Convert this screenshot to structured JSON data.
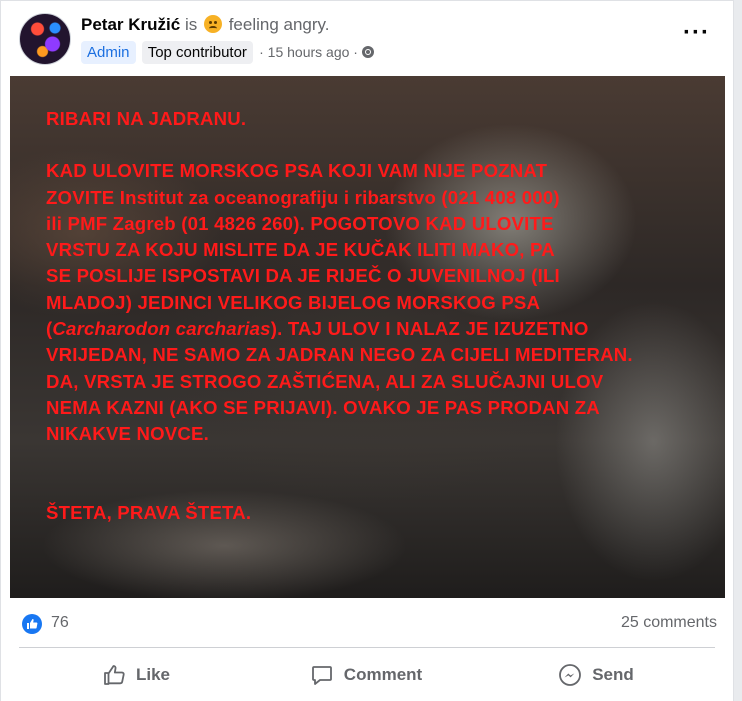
{
  "post": {
    "author": "Petar Kružić",
    "activity_prefix": "is",
    "feeling_icon": "angry-face-icon",
    "feeling": "feeling angry.",
    "badges": {
      "admin": "Admin",
      "top": "Top contributor"
    },
    "time": "· 15 hours ago ·",
    "privacy_icon": "globe-icon",
    "more_label": "···"
  },
  "image_text": {
    "title": "RIBARI NA JADRANU.",
    "lines": [
      "KAD ULOVITE MORSKOG PSA KOJI VAM NIJE POZNAT",
      "ZOVITE Institut za oceanografiju i ribarstvo (021 408 000)",
      "ili PMF Zagreb (01 4826 260). POGOTOVO KAD ULOVITE",
      "VRSTU ZA KOJU MISLITE DA JE KUČAK ILITI MAKO, PA",
      "SE POSLIJE ISPOSTAVI DA JE RIJEČ O JUVENILNOJ (ILI",
      "MLADOJ) JEDINCI VELIKOG BIJELOG MORSKOG PSA"
    ],
    "species_open": "(",
    "species": "Carcharodon carcharias",
    "species_rest": "). TAJ ULOV I NALAZ JE IZUZETNO",
    "lines2": [
      "VRIJEDAN, NE SAMO ZA JADRAN NEGO ZA CIJELI MEDITERAN.",
      "DA, VRSTA JE STROGO ZAŠTIĆENA, ALI ZA SLUČAJNI ULOV",
      "NEMA KAZNI (AKO SE PRIJAVI). OVAKO JE PAS PRODAN ZA",
      "NIKAKVE NOVCE."
    ],
    "closing": "ŠTETA, PRAVA ŠTETA."
  },
  "stats": {
    "likes": "76",
    "comments": "25 comments"
  },
  "actions": {
    "like": "Like",
    "comment": "Comment",
    "send": "Send"
  },
  "colors": {
    "accent": "#1877f2",
    "image_text": "#ff1a1a",
    "muted": "#65676b"
  }
}
